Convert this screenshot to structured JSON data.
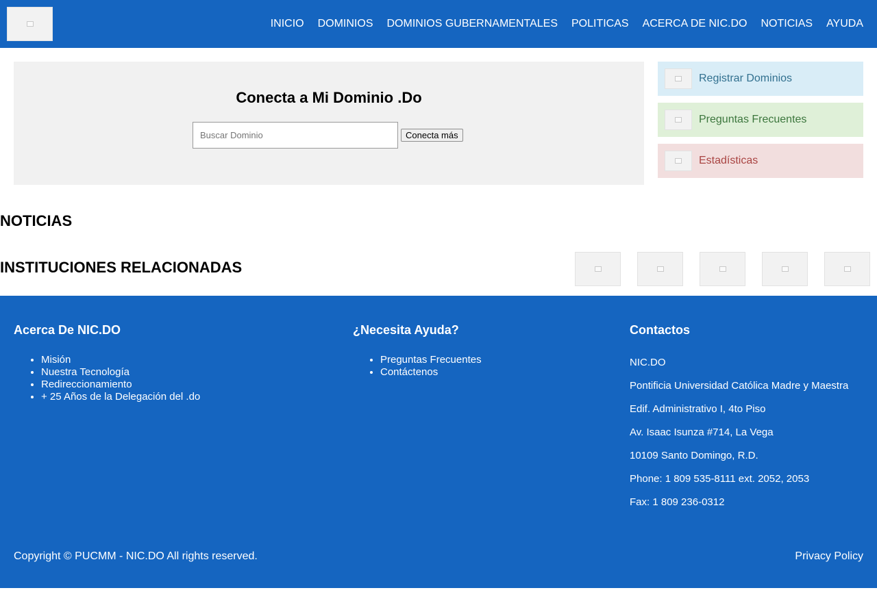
{
  "header": {
    "logo_icon": "nic-do-logo",
    "nav": [
      {
        "label": "INICIO"
      },
      {
        "label": "DOMINIOS"
      },
      {
        "label": "DOMINIOS GUBERNAMENTALES"
      },
      {
        "label": "POLITICAS"
      },
      {
        "label": "ACERCA DE NIC.DO"
      },
      {
        "label": "NOTICIAS"
      },
      {
        "label": "AYUDA"
      }
    ]
  },
  "hero": {
    "title": "Conecta a Mi Dominio .Do",
    "search_placeholder": "Buscar Dominio",
    "search_value": "",
    "button_label": "Conecta más"
  },
  "quick_links": [
    {
      "label": "Registrar Dominios",
      "bg": "#d9edf7",
      "color": "#31708f",
      "icon": "register-domain-icon"
    },
    {
      "label": "Preguntas Frecuentes",
      "bg": "#dff0d8",
      "color": "#3c763d",
      "icon": "faq-icon"
    },
    {
      "label": "Estadísticas",
      "bg": "#f2dede",
      "color": "#a94442",
      "icon": "statistics-icon"
    }
  ],
  "news": {
    "title": "NOTICIAS"
  },
  "institutions": {
    "title": "INSTITUCIONES RELACIONADAS",
    "logo_count": 5
  },
  "footer": {
    "about": {
      "title": "Acerca De NIC.DO",
      "links": [
        "Misión",
        "Nuestra Tecnología",
        "Redireccionamiento",
        "+ 25 Años de la Delegación del .do"
      ]
    },
    "help": {
      "title": "¿Necesita Ayuda?",
      "links": [
        "Preguntas Frecuentes",
        "Contáctenos"
      ]
    },
    "contacts": {
      "title": "Contactos",
      "lines": [
        "NIC.DO",
        "Pontificia Universidad Católica Madre y Maestra",
        "Edif. Administrativo I, 4to Piso",
        "Av. Isaac Isunza #714, La Vega",
        "10109 Santo Domingo, R.D.",
        "Phone: 1 809 535-8111 ext. 2052, 2053",
        "Fax: 1 809 236-0312"
      ]
    },
    "copyright": "Copyright © PUCMM - NIC.DO All rights reserved.",
    "privacy": "Privacy Policy"
  },
  "colors": {
    "brand_blue": "#1565c0",
    "hero_bg": "#f1f1f1"
  }
}
